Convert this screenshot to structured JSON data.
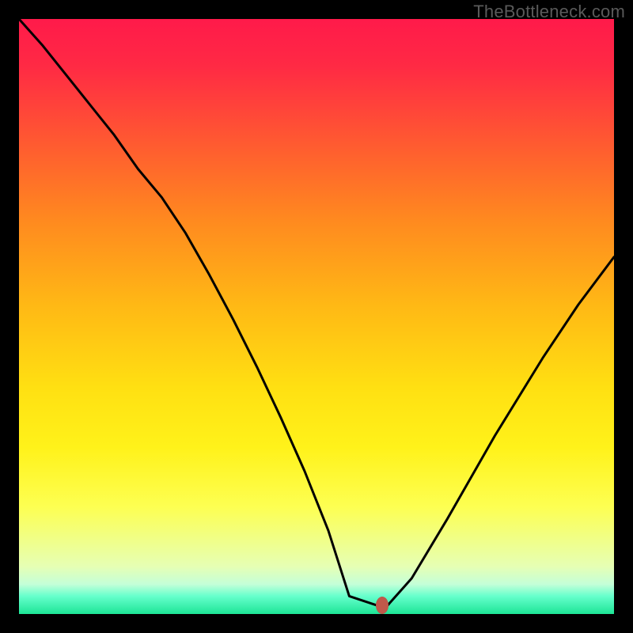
{
  "watermark": "TheBottleneck.com",
  "colors": {
    "frame_bg": "#000000",
    "curve_stroke": "#000000",
    "marker_fill": "#c0584a"
  },
  "marker": {
    "x_norm": 0.61,
    "y_norm": 0.985
  },
  "chart_data": {
    "type": "line",
    "title": "",
    "xlabel": "",
    "ylabel": "",
    "xlim": [
      0,
      1
    ],
    "ylim": [
      0,
      1
    ],
    "grid": false,
    "legend": false,
    "annotations": [
      {
        "text": "TheBottleneck.com",
        "position": "top-right"
      }
    ],
    "series": [
      {
        "name": "bottleneck-curve",
        "x": [
          0.0,
          0.04,
          0.08,
          0.12,
          0.16,
          0.2,
          0.24,
          0.28,
          0.32,
          0.36,
          0.4,
          0.44,
          0.48,
          0.52,
          0.555,
          0.6,
          0.62,
          0.66,
          0.72,
          0.8,
          0.88,
          0.94,
          1.0
        ],
        "y": [
          1.0,
          0.955,
          0.905,
          0.855,
          0.805,
          0.748,
          0.7,
          0.64,
          0.57,
          0.495,
          0.415,
          0.33,
          0.24,
          0.14,
          0.03,
          0.015,
          0.015,
          0.06,
          0.16,
          0.3,
          0.43,
          0.52,
          0.6
        ]
      }
    ],
    "markers": [
      {
        "name": "selected-point",
        "x": 0.61,
        "y": 0.015
      }
    ],
    "background_gradient": {
      "orientation": "vertical",
      "stops": [
        {
          "pos": 0.0,
          "color": "#ff1a4a"
        },
        {
          "pos": 0.22,
          "color": "#ff5e2f"
        },
        {
          "pos": 0.48,
          "color": "#ffb815"
        },
        {
          "pos": 0.72,
          "color": "#fff21a"
        },
        {
          "pos": 0.92,
          "color": "#e6ffb4"
        },
        {
          "pos": 1.0,
          "color": "#1de596"
        }
      ]
    }
  }
}
